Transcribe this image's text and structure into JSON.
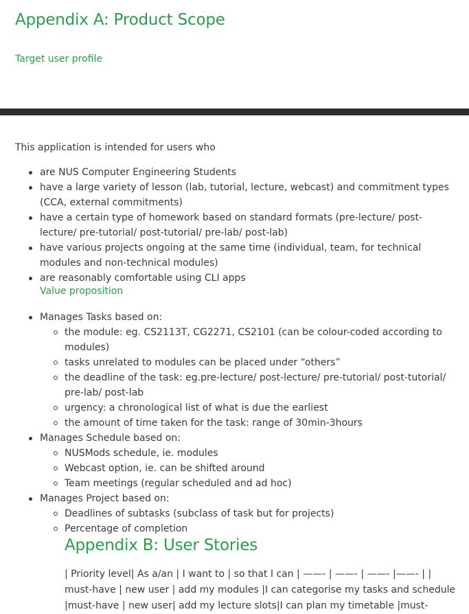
{
  "appendix_a": {
    "title": "Appendix A: Product Scope",
    "target_user_heading": "Target user profile",
    "intro": "This application is intended for users who",
    "users": [
      "are NUS Computer Engineering Students",
      "have a large variety of lesson (lab, tutorial, lecture, webcast) and commitment types (CCA, external commitments)",
      "have a certain type of homework based on standard formats (pre-lecture/ post-lecture/ pre-tutorial/ post-tutorial/ pre-lab/ post-lab)",
      "have various projects ongoing at the same time (individual, team, for technical modules and non-technical modules)",
      "are reasonably comfortable using CLI apps"
    ],
    "value_prop_heading": "Value proposition",
    "tasks": {
      "label": "Manages Tasks based on:",
      "items": [
        "the module: eg. CS2113T, CG2271, CS2101 (can be colour-coded according to modules)",
        "tasks unrelated to modules can be placed under “others”",
        "the deadline of the task: eg.pre-lecture/ post-lecture/ pre-tutorial/ post-tutorial/ pre-lab/ post-lab",
        "urgency: a chronological list of what is due the earliest",
        "the amount of time taken for the task: range of 30min-3hours"
      ]
    },
    "schedule": {
      "label": "Manages Schedule based on:",
      "items": [
        "NUSMods schedule, ie. modules",
        "Webcast option, ie. can be shifted around",
        "Team meetings (regular scheduled and ad hoc)"
      ]
    },
    "project": {
      "label": "Manages Project based on:",
      "items": [
        "Deadlines of subtasks (subclass of task but for projects)",
        "Percentage of completion"
      ]
    }
  },
  "appendix_b": {
    "title": "Appendix B: User Stories",
    "stories_text": "| Priority level| As a/an | I want to | so that I can | ——- | ——- | ——- |——- | | must-have | new user | add my modules |I can categorise my tasks and schedule |must-have | new user| add my lecture slots|I can plan my timetable |must-"
  },
  "colors": {
    "heading_green": "#27a047",
    "bar": "#2d2d2d",
    "text": "#3a3a3a"
  }
}
